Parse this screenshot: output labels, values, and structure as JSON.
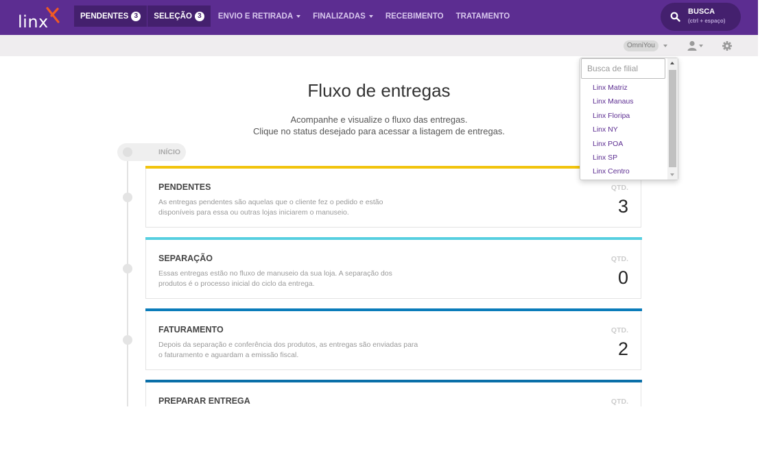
{
  "app": {
    "logo_text": "linx",
    "brand_color": "#5c2d91",
    "accent_color": "#f15a24"
  },
  "nav": {
    "items": [
      {
        "label": "PENDENTES",
        "badge": "3",
        "active": true
      },
      {
        "label": "SELEÇÃO",
        "badge": "3",
        "active": true
      },
      {
        "label": "ENVIO E RETIRADA",
        "has_caret": true
      },
      {
        "label": "FINALIZADAS",
        "has_caret": true
      },
      {
        "label": "RECEBIMENTO"
      },
      {
        "label": "TRATAMENTO"
      }
    ],
    "search": {
      "label": "BUSCA",
      "hint": "(ctrl + espaço)",
      "icon": "search-icon"
    }
  },
  "subbar": {
    "store_selector": "OmniYou",
    "user_icon": "user-icon",
    "settings_icon": "gear-icon"
  },
  "page": {
    "title": "Fluxo de entregas",
    "subtitle_line1": "Acompanhe e visualize o fluxo das entregas.",
    "subtitle_line2": "Clique no status desejado para acessar a listagem de entregas.",
    "start_label": "INÍCIO"
  },
  "cards": [
    {
      "title": "PENDENTES",
      "desc": "As entregas pendentes são aquelas que o cliente fez o pedido e estão disponíveis para essa ou outras lojas iniciarem o manuseio.",
      "qtd_label": "QTD.",
      "qtd": "3",
      "color": "#f2c40d"
    },
    {
      "title": "SEPARAÇÃO",
      "desc": "Essas entregas estão no fluxo de manuseio da sua loja. A separação dos produtos é o processo inicial do ciclo da entrega.",
      "qtd_label": "QTD.",
      "qtd": "0",
      "color": "#56cfe0"
    },
    {
      "title": "FATURAMENTO",
      "desc": "Depois da separação e conferência dos produtos, as entregas são enviadas para o faturamento e aguardam a emissão fiscal.",
      "qtd_label": "QTD.",
      "qtd": "2",
      "color": "#0a7cba"
    },
    {
      "title": "PREPARAR ENTREGA",
      "desc": "",
      "qtd_label": "QTD.",
      "qtd": "",
      "color": "#0a6fa8"
    }
  ],
  "branch_dropdown": {
    "placeholder": "Busca de filial",
    "options": [
      "Linx Matriz",
      "Linx Manaus",
      "Linx Floripa",
      "Linx NY",
      "Linx POA",
      "Linx SP",
      "Linx Centro"
    ]
  }
}
